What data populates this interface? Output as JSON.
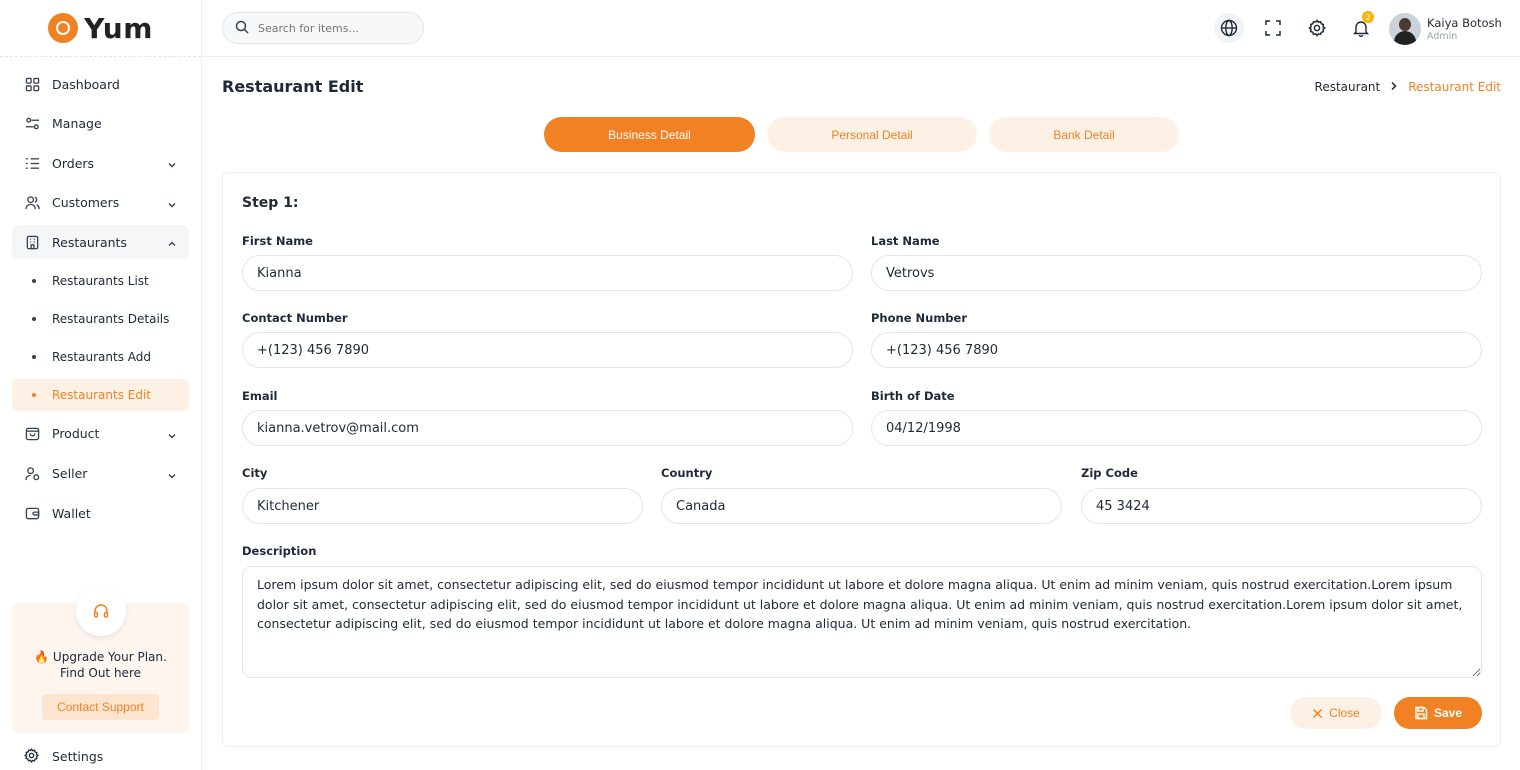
{
  "brand": {
    "name": "Yum",
    "accent": "#f28123"
  },
  "search": {
    "placeholder": "Search for items..."
  },
  "header": {
    "notification_count": "2",
    "user_name": "Kaiya Botosh",
    "user_role": "Admin"
  },
  "sidebar": {
    "items": [
      {
        "label": "Dashboard",
        "icon": "grid-icon"
      },
      {
        "label": "Manage",
        "icon": "sliders-icon"
      },
      {
        "label": "Orders",
        "icon": "list-icon"
      },
      {
        "label": "Customers",
        "icon": "users-icon"
      },
      {
        "label": "Restaurants",
        "icon": "building-icon"
      },
      {
        "label": "Product",
        "icon": "bag-icon"
      },
      {
        "label": "Seller",
        "icon": "seller-icon"
      },
      {
        "label": "Wallet",
        "icon": "wallet-icon"
      }
    ],
    "restaurant_sub": [
      "Restaurants List",
      "Restaurants Details",
      "Restaurants Add",
      "Restaurants Edit"
    ],
    "upgrade_text": "🔥 Upgrade Your Plan. Find Out here",
    "contact_label": "Contact Support",
    "settings_label": "Settings"
  },
  "page": {
    "title": "Restaurant Edit",
    "breadcrumb": [
      "Restaurant",
      "Restaurant Edit"
    ]
  },
  "tabs": [
    "Business Detail",
    "Personal Detail",
    "Bank Detail"
  ],
  "form": {
    "step": "Step 1:",
    "first_name": {
      "label": "First Name",
      "value": "Kianna"
    },
    "last_name": {
      "label": "Last Name",
      "value": "Vetrovs"
    },
    "contact_number": {
      "label": "Contact Number",
      "value": "+(123) 456 7890"
    },
    "phone_number": {
      "label": "Phone Number",
      "value": "+(123) 456 7890"
    },
    "email": {
      "label": "Email",
      "value": "kianna.vetrov@mail.com"
    },
    "birth_date": {
      "label": "Birth of Date",
      "value": "04/12/1998"
    },
    "city": {
      "label": "City",
      "value": "Kitchener"
    },
    "country": {
      "label": "Country",
      "value": "Canada"
    },
    "zip": {
      "label": "Zip Code",
      "value": "45 3424"
    },
    "description": {
      "label": "Description",
      "value": "Lorem ipsum dolor sit amet, consectetur adipiscing elit, sed do eiusmod tempor incididunt ut labore et dolore magna aliqua. Ut enim ad minim veniam, quis nostrud exercitation.Lorem ipsum dolor sit amet, consectetur adipiscing elit, sed do eiusmod tempor incididunt ut labore et dolore magna aliqua. Ut enim ad minim veniam, quis nostrud exercitation.Lorem ipsum dolor sit amet, consectetur adipiscing elit, sed do eiusmod tempor incididunt ut labore et dolore magna aliqua. Ut enim ad minim veniam, quis nostrud exercitation."
    },
    "close_label": "Close",
    "save_label": "Save"
  }
}
